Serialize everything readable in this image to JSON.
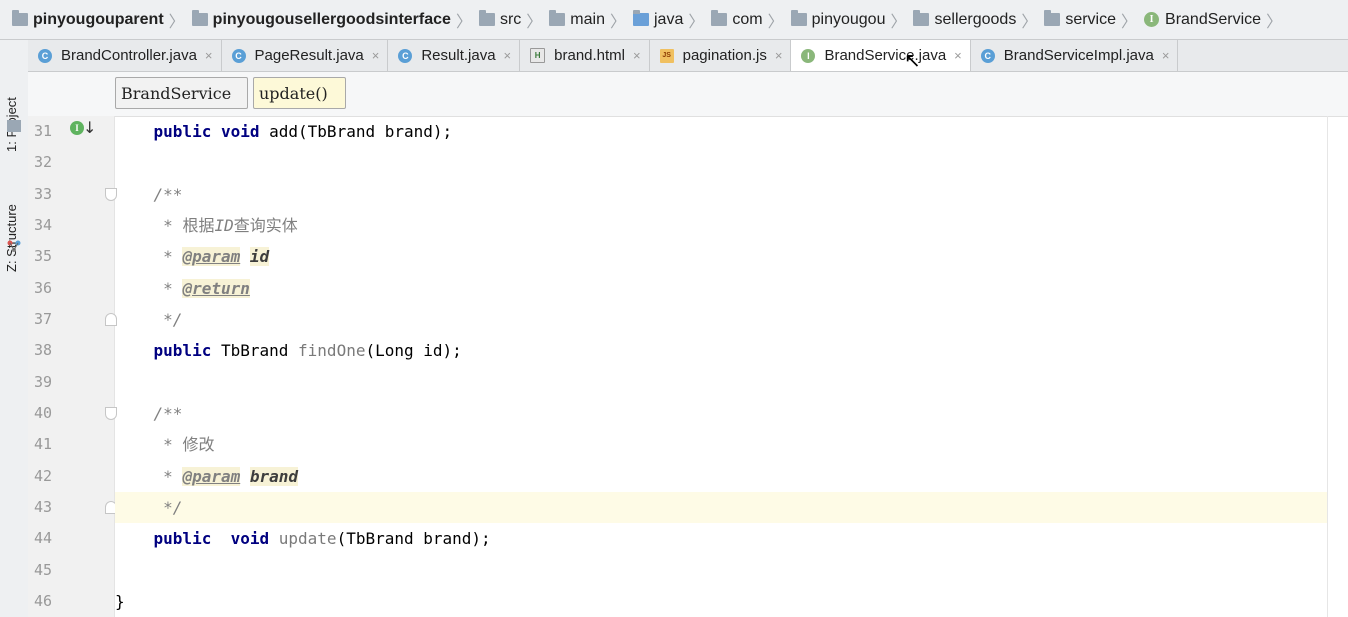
{
  "breadcrumbs": [
    {
      "label": "pinyougouparent",
      "icon": "module-folder-icon",
      "bold": true
    },
    {
      "label": "pinyougousellergoodsinterface",
      "icon": "module-folder-icon",
      "bold": true
    },
    {
      "label": "src",
      "icon": "folder-icon"
    },
    {
      "label": "main",
      "icon": "folder-icon"
    },
    {
      "label": "java",
      "icon": "source-folder-icon"
    },
    {
      "label": "com",
      "icon": "package-icon"
    },
    {
      "label": "pinyougou",
      "icon": "package-icon"
    },
    {
      "label": "sellergoods",
      "icon": "package-icon"
    },
    {
      "label": "service",
      "icon": "package-icon"
    },
    {
      "label": "BrandService",
      "icon": "interface-icon"
    }
  ],
  "toolwindows": {
    "project": "1: Project",
    "structure": "Z: Structure"
  },
  "tabs": [
    {
      "label": "BrandController.java",
      "icon": "class-icon",
      "close": "×"
    },
    {
      "label": "PageResult.java",
      "icon": "class-icon",
      "close": "×"
    },
    {
      "label": "Result.java",
      "icon": "class-icon",
      "close": "×"
    },
    {
      "label": "brand.html",
      "icon": "html-file-icon",
      "close": "×"
    },
    {
      "label": "pagination.js",
      "icon": "js-file-icon",
      "close": "×"
    },
    {
      "label": "BrandService.java",
      "icon": "interface-icon",
      "close": "×",
      "active": true
    },
    {
      "label": "BrandServiceImpl.java",
      "icon": "class-icon",
      "close": "×"
    }
  ],
  "structure_path": {
    "class": "BrandService",
    "method": "update()"
  },
  "line_numbers": [
    "31",
    "32",
    "33",
    "34",
    "35",
    "36",
    "37",
    "38",
    "39",
    "40",
    "41",
    "42",
    "43",
    "44",
    "45",
    "46"
  ],
  "code": {
    "l31": {
      "kw1": "public",
      "kw2": "void",
      "rest": " add(TbBrand brand);"
    },
    "l33": "/**",
    "l34": {
      "star": " * ",
      "t1": "根据",
      "t2": "ID",
      "t3": "查询实体"
    },
    "l35": {
      "star": " * ",
      "tag": "@param",
      "param": "id"
    },
    "l36": {
      "star": " * ",
      "tag": "@return"
    },
    "l37": " */",
    "l38": {
      "kw": "public",
      "type": " TbBrand ",
      "method": "findOne",
      "rest": "(Long id);"
    },
    "l40": "/**",
    "l41": {
      "star": " * ",
      "text": "修改"
    },
    "l42": {
      "star": " * ",
      "tag": "@param",
      "param": "brand"
    },
    "l43": " */",
    "l44": {
      "kw1": "public",
      "kw2": "void",
      "method": "update",
      "rest": "(TbBrand brand);"
    },
    "l46": "}"
  },
  "colors": {
    "keyword": "#000080",
    "comment": "#808080",
    "current_line": "#fefbe6"
  }
}
